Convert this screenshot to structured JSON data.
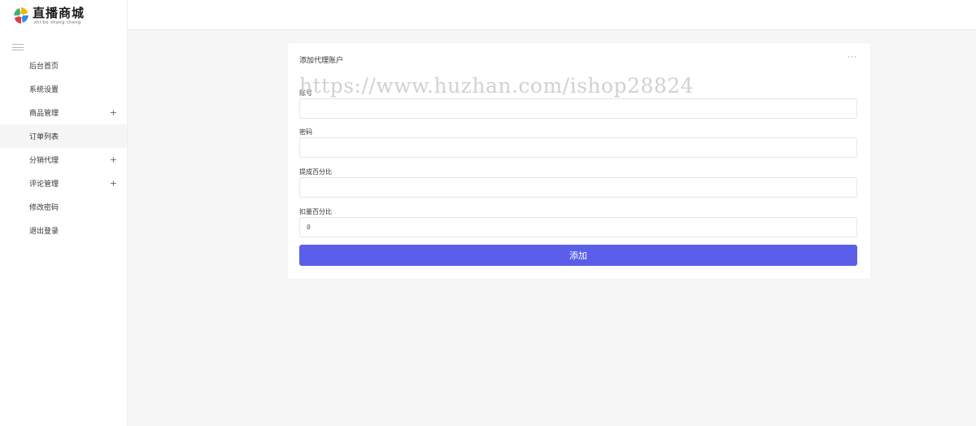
{
  "logo": {
    "name_cn": "直播商城",
    "name_en": "zhi bo shang cheng"
  },
  "sidebar": {
    "items": [
      {
        "label": "后台首页",
        "expandable": false,
        "active": false
      },
      {
        "label": "系统设置",
        "expandable": false,
        "active": false
      },
      {
        "label": "商品管理",
        "expandable": true,
        "active": false
      },
      {
        "label": "订单列表",
        "expandable": false,
        "active": true
      },
      {
        "label": "分销代理",
        "expandable": true,
        "active": false
      },
      {
        "label": "评论管理",
        "expandable": true,
        "active": false
      },
      {
        "label": "修改密码",
        "expandable": false,
        "active": false
      },
      {
        "label": "退出登录",
        "expandable": false,
        "active": false
      }
    ],
    "plus_symbol": "+"
  },
  "card": {
    "title": "添加代理账户",
    "more": "···",
    "fields": [
      {
        "label": "账号",
        "value": ""
      },
      {
        "label": "密码",
        "value": ""
      },
      {
        "label": "提成百分比",
        "value": ""
      },
      {
        "label": "扣量百分比",
        "value": "0"
      }
    ],
    "submit_label": "添加"
  },
  "watermark": "https://www.huzhan.com/ishop28824",
  "colors": {
    "accent": "#5b5ee8",
    "background": "#f6f6f7",
    "sidebar_active": "#f5f5f5"
  }
}
